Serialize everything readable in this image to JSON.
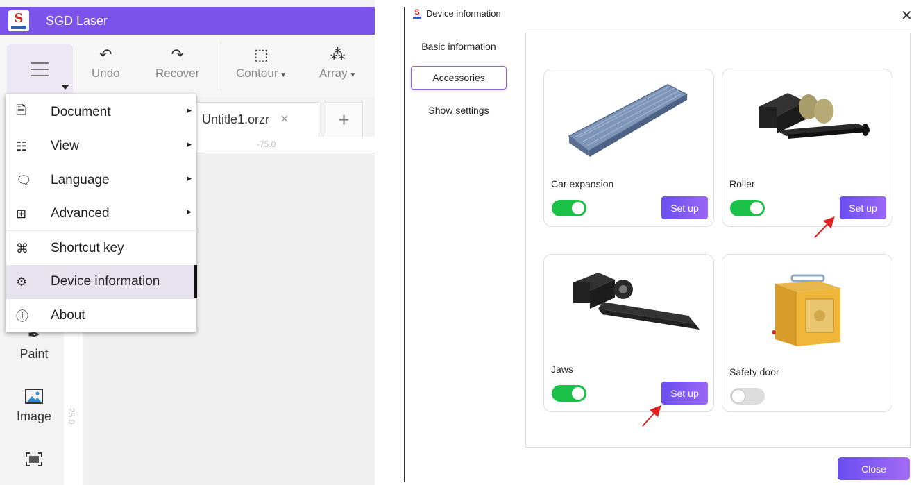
{
  "app": {
    "title": "SGD Laser",
    "logo_text": "S",
    "logo_caption": "SGD Laser"
  },
  "toolbar": {
    "undo_label": "Undo",
    "recover_label": "Recover",
    "contour_label": "Contour",
    "array_label": "Array"
  },
  "tabs": {
    "file_name": "Untitle1.orzr",
    "close_glyph": "×",
    "add_glyph": "+"
  },
  "rulers": {
    "top_mark": "-75.0",
    "left_mark": "25.0"
  },
  "menu": {
    "items": [
      {
        "label": "Document",
        "icon": "document-icon",
        "has_submenu": true
      },
      {
        "label": "View",
        "icon": "view-list-icon",
        "has_submenu": true
      },
      {
        "label": "Language",
        "icon": "language-icon",
        "has_submenu": true
      },
      {
        "label": "Advanced",
        "icon": "advanced-grid-icon",
        "has_submenu": true
      },
      {
        "label": "Shortcut key",
        "icon": "command-key-icon",
        "has_submenu": false
      },
      {
        "label": "Device information",
        "icon": "device-settings-icon",
        "has_submenu": false,
        "active": true
      },
      {
        "label": "About",
        "icon": "info-icon",
        "has_submenu": false
      }
    ]
  },
  "sidetools": {
    "paint_label": "Paint",
    "image_label": "Image"
  },
  "dialog": {
    "title": "Device information",
    "nav": [
      {
        "label": "Basic information"
      },
      {
        "label": "Accessories",
        "selected": true
      },
      {
        "label": "Show settings"
      }
    ],
    "cards": [
      {
        "label": "Car expansion",
        "enabled": true,
        "button": "Set up"
      },
      {
        "label": "Roller",
        "enabled": true,
        "button": "Set up"
      },
      {
        "label": "Jaws",
        "enabled": true,
        "button": "Set up"
      },
      {
        "label": "Safety door",
        "enabled": false
      }
    ],
    "close_label": "Close"
  },
  "colors": {
    "accent": "#7b53ea",
    "toggle_on": "#19c146",
    "arrow": "#e02020"
  }
}
